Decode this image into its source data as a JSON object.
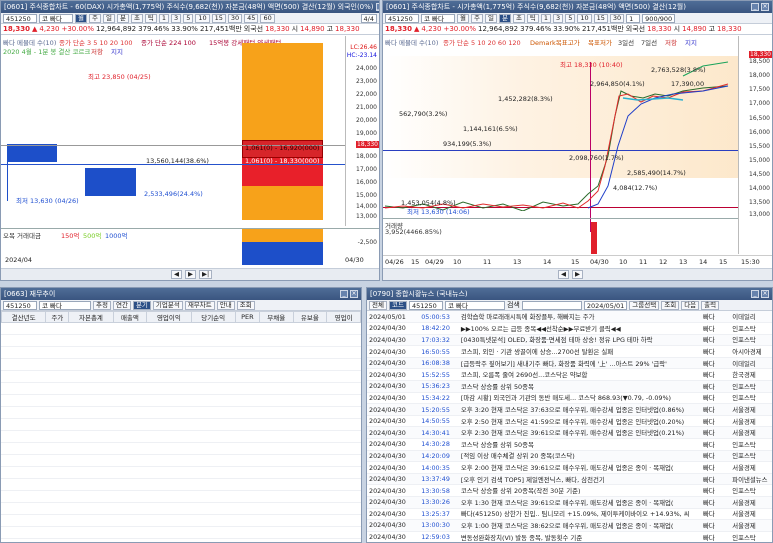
{
  "w1": {
    "title": "[0601] 주식종합차트 - 60(DAX) 시가총액(1,775억) 주식수(9,682(천)) 자본금(48억) 액면(500) 결산(12월) 외국인(0%)",
    "code": "451250",
    "name": "코 빠다",
    "periods": [
      "월",
      "주",
      "일",
      "분",
      "초",
      "틱"
    ],
    "nums": [
      "1",
      "3",
      "5",
      "10",
      "15",
      "30",
      "45",
      "60"
    ],
    "page": "4/4",
    "quote": [
      "18,330",
      "▲",
      "4,230",
      "+30.00%",
      "12,964,892",
      "379.46%",
      "33.90%",
      "217,451백만",
      "외국선",
      "18,330",
      "시",
      "14,890",
      "고",
      "18,330"
    ],
    "legend1": "빠다 메뮬데 수(10)",
    "legend1b": "종가 단순 3 5 10 20 100",
    "legend2": "종가 단순 224 100",
    "legend3": "15억봉 강세패턴 약세패턴",
    "legend4": "2020 4월 - 1분 봉 결산 코르크",
    "legend5": "저항",
    "legend6": "지지",
    "ticks": [
      "24,000",
      "23,000",
      "22,000",
      "21,000",
      "20,000",
      "19,000",
      "18,000",
      "17,000",
      "16,000",
      "15,000",
      "14,000",
      "13,000",
      "12,000"
    ],
    "rt": [
      "LC:26.46",
      "HC:-23.14"
    ],
    "price_tag": "18,330",
    "hi": "최고 23,850 (04/25)",
    "lo": "최저 13,630 (04/26)",
    "mid": "13,560,144(38.6%)",
    "mid2": "1,061(0) - 18,330(000)",
    "mid3": "2,533,496(24.4%)",
    "mid4": "1,061(0) - 16,920(000)",
    "vol_legend": [
      "오목 거래대금",
      "150억",
      "500억",
      "1000억"
    ],
    "vol_tick": "-2,500",
    "date_left": "2024/04",
    "date_right": "04/30"
  },
  "w2": {
    "title": "[0601] 주식종합차트 - 시가총액(1,775억) 주식수(9,682(천)) 자본금(48억) 액면(500) 결산(12월)",
    "code": "451250",
    "name": "코 빠다",
    "page": "1",
    "count": "900/900",
    "quote": [
      "18,330",
      "▲",
      "4,230",
      "+30.00%",
      "12,964,892",
      "379.46%",
      "33.90%",
      "217,451백만",
      "외국선",
      "18,330",
      "시",
      "14,890",
      "고",
      "18,330"
    ],
    "legend": [
      "빠다 메뮬데 수(10)",
      "종가 단순 5 10 20 60 120",
      "Demark목표고가",
      "목표저가",
      "3일선",
      "7일선",
      "저항",
      "지지"
    ],
    "ticks": [
      "18,500",
      "18,000",
      "17,500",
      "17,000",
      "16,500",
      "16,000",
      "15,500",
      "15,000",
      "14,500",
      "14,000",
      "13,500",
      "13,000"
    ],
    "xt": [
      "04/26",
      "15",
      "04/29",
      "10",
      "11",
      "13",
      "14",
      "15",
      "04/30",
      "10",
      "11",
      "12",
      "13",
      "14",
      "15",
      "15:30"
    ],
    "labels": {
      "a": "최고 18,330 (10:40)",
      "b": "2,763,528(3.8%)",
      "c": "2,964,850(4.1%)",
      "d": "17,390,00",
      "e": "1,452,282(8.3%)",
      "f": "562,790(3.2%)",
      "g": "1,144,161(6.5%)",
      "h": "934,199(5.3%)",
      "i": "2,098,760(1.7%)",
      "j": "2,585,490(14.7%)",
      "k": "4,084(12.7%)",
      "l": "1,453,054(4.8%)",
      "m": "최저 13,630 (14:06)",
      "n": "거래량",
      "o": "3,952(4466.85%)"
    },
    "price_tag": "18,330"
  },
  "w3": {
    "title": "[0663] 재무추이",
    "code": "451250",
    "name": "코 빠다",
    "tabs": [
      "추정",
      "연간",
      "분기",
      "기업분석",
      "재무차트",
      "안내",
      "조회"
    ],
    "cols": [
      "결산년도",
      "주가",
      "자본총계",
      "매출액",
      "영업이익",
      "당기순익",
      "PER",
      "부채율",
      "유보율",
      "영업이"
    ]
  },
  "w4": {
    "title": "[0790] 종합시황뉴스 (국내뉴스)",
    "pill": "전체",
    "pill2": "코드",
    "code": "451250",
    "name": "코 빠다",
    "search": "검색",
    "date": "2024/05/01",
    "group": "그룹선택",
    "btns": [
      "조회",
      "다음",
      "출력"
    ],
    "rows": [
      [
        "2024/05/01",
        "05:00:53",
        "검학습학  마로래래시특에  화장플투, 해빠지는 주가",
        "빠다",
        "이데일리"
      ],
      [
        "2024/04/30",
        "18:42:20",
        "▶▶100% 오르는 급등 종목◀◀선착순▶▶무료받기 클릭◀◀",
        "빠다",
        "인포스탁"
      ],
      [
        "2024/04/30",
        "17:03:32",
        "[0430특넷분석] OLED, 화장품·면세점 테마 상숭! 정유  LPG 테마 하락",
        "빠다",
        "인포스탁"
      ],
      [
        "2024/04/30",
        "16:50:55",
        "코스피, 외인 · 기관 쌍끌이에 상승...2700선 탈환은 실패",
        "빠다",
        "아시아경제"
      ],
      [
        "2024/04/30",
        "16:08:38",
        "[급등락주 짚어보기] 새내기주 빠다, 화장품 화력에 '上' ...아스트 29%  '급락'",
        "빠다",
        "이데일리"
      ],
      [
        "2024/04/30",
        "15:52:55",
        "코스피, 오름폭 줄여 2690선...코스닥은 약보합",
        "빠다",
        "한국경제"
      ],
      [
        "2024/04/30",
        "15:36:23",
        "코스닥 상승률 상위 50종목",
        "빠다",
        "인포스탁"
      ],
      [
        "2024/04/30",
        "15:34:22",
        "[마감 시황] 외국인과 기관의 동반 매도세... 코스닥 868.93(▼0.79, -0.09%)",
        "빠다",
        "인포스탁"
      ],
      [
        "2024/04/30",
        "15:20:55",
        "오후 3:20 현재 코스닥은 37:63으로 매수우위, 매수강세 업종은 인터넷업(0.86%)",
        "빠다",
        "서울경제"
      ],
      [
        "2024/04/30",
        "14:50:55",
        "오후 2:50 현재 코스닥은 41:59으로 매수우위, 매수강세 업종은 인터넷업(0.20%)",
        "빠다",
        "서울경제"
      ],
      [
        "2024/04/30",
        "14:30:41",
        "오후 2:30 현재 코스닥은 39:61으로 매수우위, 매수강세 업종은 인터넷업(0.21%)",
        "빠다",
        "서울경제"
      ],
      [
        "2024/04/30",
        "14:30:28",
        "코스닥 상승률 상위 50종목",
        "빠다",
        "인포스탁"
      ],
      [
        "2024/04/30",
        "14:20:09",
        "[적임 이상 매수체결 상위 20 종목(코스닥)",
        "빠다",
        "인포스탁"
      ],
      [
        "2024/04/30",
        "14:00:35",
        "오후 2:00 현재 코스닥은 39:61으로 매수우위, 매도강세 업종은 종이 · 목재업(",
        "빠다",
        "서울경제"
      ],
      [
        "2024/04/30",
        "13:37:49",
        "[오후 인기 검색 TOP5] 제일엔전닉스, 빠다, 삼천건기",
        "빠다",
        "파이낸셜뉴스"
      ],
      [
        "2024/04/30",
        "13:30:58",
        "코스닥 상승률 상위 20종목(작전 30분 기준)",
        "빠다",
        "인포스탁"
      ],
      [
        "2024/04/30",
        "13:30:26",
        "오후 1:30 현재 코스닥은 39:61으로 매수우위, 매도강세 업종은 종이 · 목재업(",
        "빠다",
        "서울경제"
      ],
      [
        "2024/04/30",
        "13:25:37",
        "빠다(451250)  상한가 진입.. 팀니모리 +15.09%, 제이투케이바이오 +14.93%, 씨",
        "빠다",
        "서울경제"
      ],
      [
        "2024/04/30",
        "13:00:30",
        "오후 1:00 현재 코스닥은 38:62으로 매수우위, 매도강세 업종은 종이 · 목재업(",
        "빠다",
        "서울경제"
      ],
      [
        "2024/04/30",
        "12:59:03",
        "변동성완화장치(VI) 발동 종목, 발동횟수 기준",
        "빠다",
        "인포스탁"
      ],
      [
        "2024/04/30",
        "12:30:26",
        "오후 12:30 현재 코스닥은 39:61으로 매수우위, 매도강세 업종은 종이 · 목재업(",
        "빠다",
        "서울경제"
      ],
      [
        "2024/04/30",
        "12:00:42",
        "[장중 시황] 코스닥 871.63, 상승세(▲1.91, +0.22%) 지속",
        "빠다",
        "인포스탁"
      ]
    ]
  }
}
